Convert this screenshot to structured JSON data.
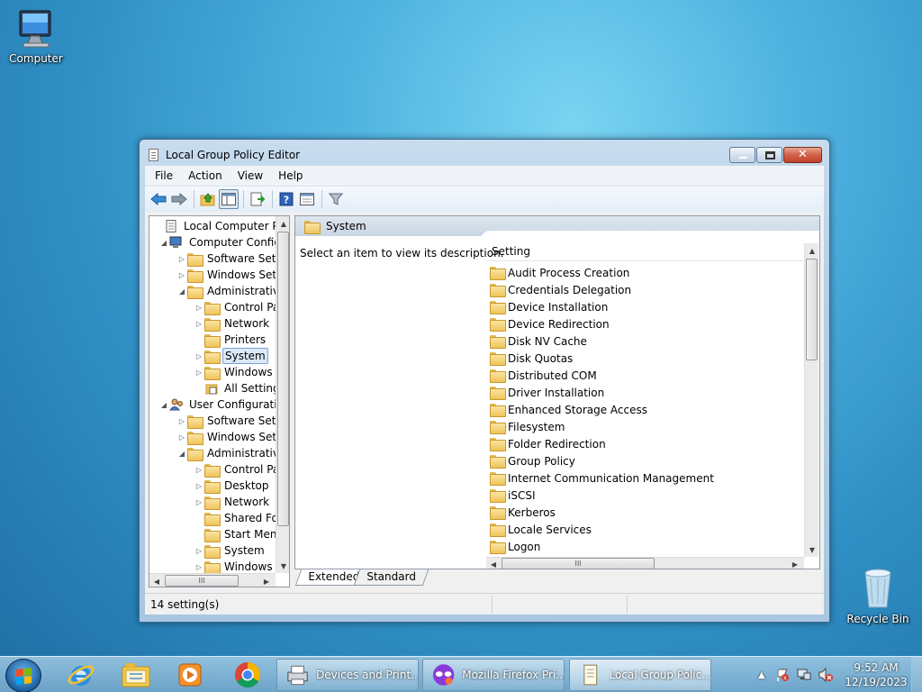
{
  "desktop": {
    "computer_label": "Computer",
    "recycle_label": "Recycle Bin"
  },
  "window": {
    "title": "Local Group Policy Editor",
    "icon": "gpedit-icon",
    "menu": [
      "File",
      "Action",
      "View",
      "Help"
    ],
    "tree": [
      {
        "label": "Local Computer Polic",
        "indent": 0,
        "expander": "",
        "icon": "policy-icon"
      },
      {
        "label": "Computer Config",
        "indent": 1,
        "expander": "◢",
        "icon": "computer-icon"
      },
      {
        "label": "Software Setti",
        "indent": 2,
        "expander": "▷",
        "icon": "folder-icon"
      },
      {
        "label": "Windows Sett",
        "indent": 2,
        "expander": "▷",
        "icon": "folder-icon"
      },
      {
        "label": "Administrative",
        "indent": 2,
        "expander": "◢",
        "icon": "folder-icon"
      },
      {
        "label": "Control Pa",
        "indent": 3,
        "expander": "▷",
        "icon": "folder-icon"
      },
      {
        "label": "Network",
        "indent": 3,
        "expander": "▷",
        "icon": "folder-icon"
      },
      {
        "label": "Printers",
        "indent": 3,
        "expander": "",
        "icon": "folder-icon"
      },
      {
        "label": "System",
        "indent": 3,
        "expander": "▷",
        "icon": "folder-icon",
        "selected": true
      },
      {
        "label": "Windows (",
        "indent": 3,
        "expander": "▷",
        "icon": "folder-icon"
      },
      {
        "label": "All Setting",
        "indent": 3,
        "expander": "",
        "icon": "all-settings-icon"
      },
      {
        "label": "User Configuratio",
        "indent": 1,
        "expander": "◢",
        "icon": "user-icon"
      },
      {
        "label": "Software Setti",
        "indent": 2,
        "expander": "▷",
        "icon": "folder-icon"
      },
      {
        "label": "Windows Sett",
        "indent": 2,
        "expander": "▷",
        "icon": "folder-icon"
      },
      {
        "label": "Administrative",
        "indent": 2,
        "expander": "◢",
        "icon": "folder-icon"
      },
      {
        "label": "Control Pa",
        "indent": 3,
        "expander": "▷",
        "icon": "folder-icon"
      },
      {
        "label": "Desktop",
        "indent": 3,
        "expander": "▷",
        "icon": "folder-icon"
      },
      {
        "label": "Network",
        "indent": 3,
        "expander": "▷",
        "icon": "folder-icon"
      },
      {
        "label": "Shared Fol",
        "indent": 3,
        "expander": "",
        "icon": "folder-icon"
      },
      {
        "label": "Start Menu",
        "indent": 3,
        "expander": "",
        "icon": "folder-icon"
      },
      {
        "label": "System",
        "indent": 3,
        "expander": "▷",
        "icon": "folder-icon"
      },
      {
        "label": "Windows (",
        "indent": 3,
        "expander": "▷",
        "icon": "folder-icon"
      }
    ],
    "tree_hscroll_grip": "III",
    "content": {
      "header": "System",
      "description": "Select an item to view its description.",
      "column_header": "Setting",
      "items": [
        "Audit Process Creation",
        "Credentials Delegation",
        "Device Installation",
        "Device Redirection",
        "Disk NV Cache",
        "Disk Quotas",
        "Distributed COM",
        "Driver Installation",
        "Enhanced Storage Access",
        "Filesystem",
        "Folder Redirection",
        "Group Policy",
        "Internet Communication Management",
        "iSCSI",
        "Kerberos",
        "Locale Services",
        "Logon"
      ],
      "hscroll_grip": "III"
    },
    "tabs": [
      "Extended",
      "Standard"
    ],
    "status": "14 setting(s)"
  },
  "taskbar": {
    "tasks": [
      {
        "label": "Devices and Print...",
        "icon": "printer-icon"
      },
      {
        "label": "Mozilla Firefox Pri...",
        "icon": "firefox-private-icon"
      },
      {
        "label": "Local Group Polic...",
        "icon": "gpedit-icon",
        "active": true
      }
    ],
    "time": "9:52 AM",
    "date": "12/19/2023"
  }
}
